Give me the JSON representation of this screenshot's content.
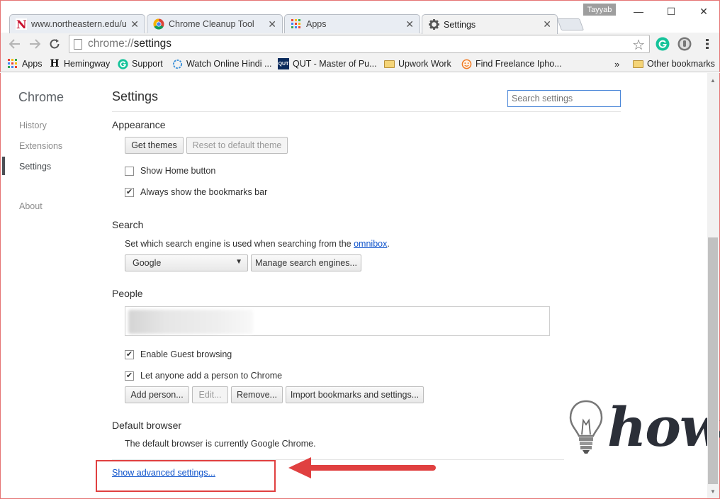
{
  "window": {
    "profile_name": "Tayyab",
    "minimize": "—",
    "maximize": "☐",
    "close": "✕"
  },
  "tabs": [
    {
      "label": "www.northeastern.edu/uh",
      "close": "✕",
      "icon": "n-logo-icon"
    },
    {
      "label": "Chrome Cleanup Tool",
      "close": "✕",
      "icon": "chrome-logo-icon"
    },
    {
      "label": "Apps",
      "close": "✕",
      "icon": "apps-grid-icon"
    },
    {
      "label": "Settings",
      "close": "✕",
      "icon": "gear-icon",
      "active": true
    }
  ],
  "toolbar": {
    "url_scheme": "chrome://",
    "url_host": "settings"
  },
  "bookmarks": {
    "items": [
      {
        "label": "Apps",
        "icon": "apps-grid-icon"
      },
      {
        "label": "Hemingway",
        "icon": "h-icon"
      },
      {
        "label": "Support",
        "icon": "grammarly-icon"
      },
      {
        "label": "Watch Online Hindi ...",
        "icon": "ring-icon"
      },
      {
        "label": "QUT - Master of Pu...",
        "icon": "qut-icon"
      },
      {
        "label": "Upwork Work",
        "icon": "folder-icon"
      },
      {
        "label": "Find Freelance Ipho...",
        "icon": "smiley-icon"
      }
    ],
    "overflow": "»",
    "other": "Other bookmarks"
  },
  "sidebar": {
    "title": "Chrome",
    "items": [
      {
        "label": "History"
      },
      {
        "label": "Extensions"
      },
      {
        "label": "Settings",
        "selected": true
      },
      {
        "label": "About"
      }
    ]
  },
  "settings": {
    "title": "Settings",
    "search_placeholder": "Search settings",
    "appearance": {
      "title": "Appearance",
      "get_themes": "Get themes",
      "reset_theme": "Reset to default theme",
      "show_home": "Show Home button",
      "show_home_checked": false,
      "show_bookmarks": "Always show the bookmarks bar",
      "show_bookmarks_checked": true
    },
    "search": {
      "title": "Search",
      "desc_prefix": "Set which search engine is used when searching from the ",
      "desc_link": "omnibox",
      "desc_suffix": ".",
      "engine": "Google",
      "manage": "Manage search engines..."
    },
    "people": {
      "title": "People",
      "guest": "Enable Guest browsing",
      "guest_checked": true,
      "anyone_add": "Let anyone add a person to Chrome",
      "anyone_add_checked": true,
      "add_person": "Add person...",
      "edit": "Edit...",
      "remove": "Remove...",
      "import": "Import bookmarks and settings..."
    },
    "default_browser": {
      "title": "Default browser",
      "status": "The default browser is currently Google Chrome."
    },
    "advanced_link": "Show advanced settings..."
  },
  "watermark": {
    "text": "how"
  },
  "colors": {
    "annotation_red": "#e04040",
    "link_blue": "#1155cc",
    "focus_blue": "#4a86d8"
  }
}
